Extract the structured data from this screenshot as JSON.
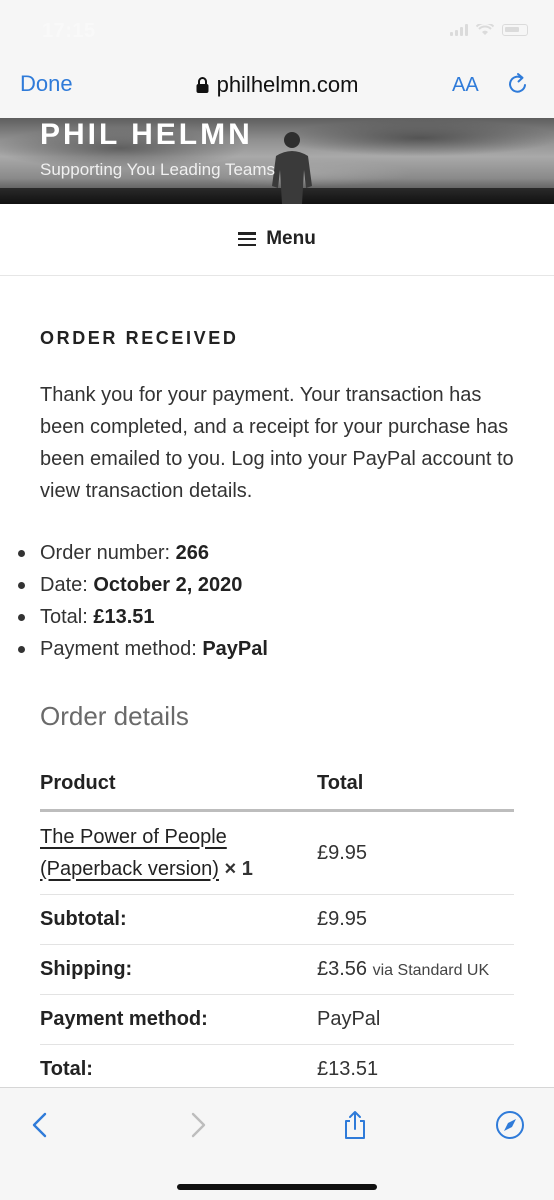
{
  "status": {
    "time": "17:15"
  },
  "browser": {
    "done_label": "Done",
    "url": "philhelmn.com",
    "text_size_label": "AA",
    "icons": [
      "lock-icon",
      "reload-icon",
      "back-icon",
      "forward-icon",
      "share-icon",
      "compass-icon"
    ],
    "accent_color": "#2f7bd9"
  },
  "site": {
    "title": "PHIL HELMN",
    "tagline": "Supporting You Leading Teams",
    "menu_label": "Menu"
  },
  "order": {
    "heading": "ORDER RECEIVED",
    "thank_you": "Thank you for your payment. Your transaction has been completed, and a receipt for your purchase has been emailed to you. Log into your PayPal account to view transaction details.",
    "overview": [
      {
        "label": "Order number:",
        "value": "266"
      },
      {
        "label": "Date:",
        "value": "October 2, 2020"
      },
      {
        "label": "Total:",
        "value": "£13.51"
      },
      {
        "label": "Payment method:",
        "value": "PayPal"
      }
    ]
  },
  "details": {
    "heading": "Order details",
    "columns": [
      "Product",
      "Total"
    ],
    "product": {
      "name_line1": "The Power of People",
      "name_line2": "(Paperback version)",
      "quantity": "× 1",
      "total": "£9.95"
    },
    "rows": [
      {
        "label": "Subtotal:",
        "value": "£9.95",
        "note": ""
      },
      {
        "label": "Shipping:",
        "value": "£3.56",
        "note": "via Standard UK"
      },
      {
        "label": "Payment method:",
        "value": "PayPal",
        "note": ""
      },
      {
        "label": "Total:",
        "value": "£13.51",
        "note": ""
      }
    ]
  }
}
